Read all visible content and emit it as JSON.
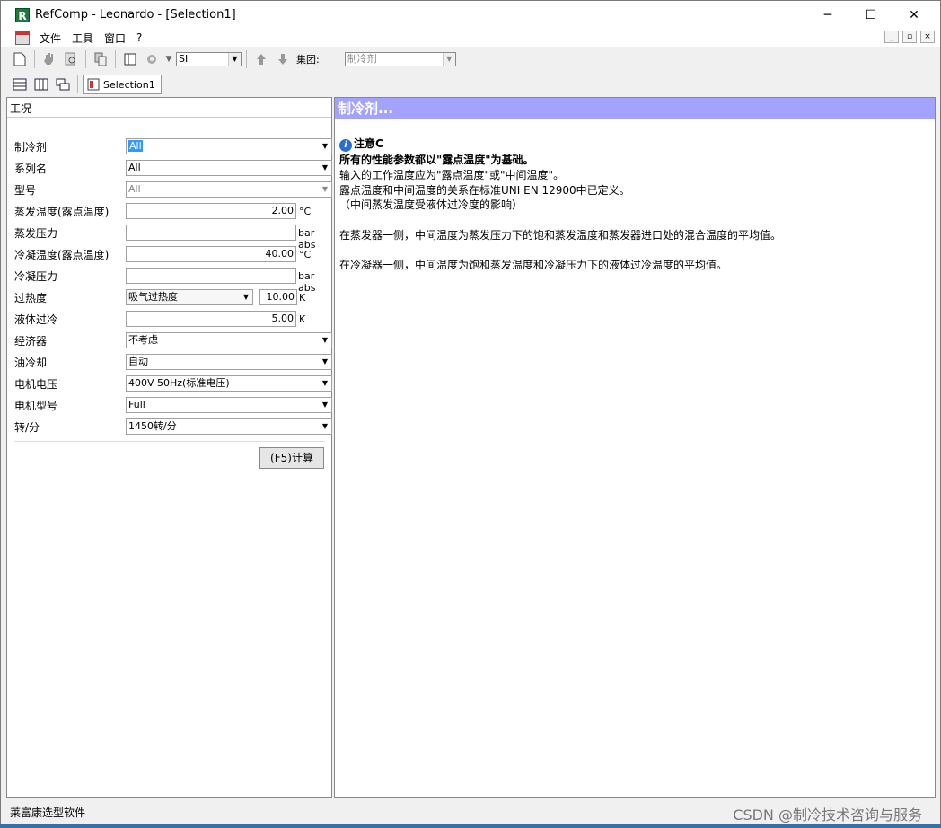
{
  "window": {
    "title": "RefComp - Leonardo  - [Selection1]",
    "app_icon": "R",
    "minimize": "─",
    "maximize": "☐",
    "close": "✕"
  },
  "menu": {
    "items": [
      "文件",
      "工具",
      "窗口",
      "?"
    ]
  },
  "mdi": {
    "min": "_",
    "restore": "▫",
    "close": "×"
  },
  "toolbar": {
    "units_value": "SI",
    "group_label": "集团:",
    "group_value": "制冷剂"
  },
  "tabs": {
    "selection_label": "Selection1"
  },
  "left_panel": {
    "title": "工况",
    "rows": [
      {
        "label": "制冷剂",
        "value": "All",
        "unit": ""
      },
      {
        "label": "系列名",
        "value": "All",
        "unit": ""
      },
      {
        "label": "型号",
        "value": "All",
        "unit": ""
      },
      {
        "label": "蒸发温度(露点温度)",
        "value": "2.00",
        "unit": "°C"
      },
      {
        "label": "蒸发压力",
        "value": "",
        "unit": "bar abs"
      },
      {
        "label": "冷凝温度(露点温度)",
        "value": "40.00",
        "unit": "°C"
      },
      {
        "label": "冷凝压力",
        "value": "",
        "unit": "bar abs"
      },
      {
        "label": "过热度",
        "value": "吸气过热度",
        "value2": "10.00",
        "unit": "K"
      },
      {
        "label": "液体过冷",
        "value": "5.00",
        "unit": "K"
      },
      {
        "label": "经济器",
        "value": "不考虑",
        "unit": ""
      },
      {
        "label": "油冷却",
        "value": "自动",
        "unit": ""
      },
      {
        "label": "电机电压",
        "value": "400V 50Hz(标准电压)",
        "unit": ""
      },
      {
        "label": "电机型号",
        "value": "Full",
        "unit": ""
      },
      {
        "label": "转/分",
        "value": "1450转/分",
        "unit": ""
      }
    ],
    "calc_button": "(F5)计算"
  },
  "right_panel": {
    "title": "制冷剂...",
    "note_title": "注意C",
    "lines": [
      "所有的性能参数都以\"露点温度\"为基础。",
      "输入的工作温度应为\"露点温度\"或\"中间温度\"。",
      "露点温度和中间温度的关系在标准UNI EN 12900中已定义。",
      "（中间蒸发温度受液体过冷度的影响）",
      "在蒸发器一侧，中间温度为蒸发压力下的饱和蒸发温度和蒸发器进口处的混合温度的平均值。",
      "在冷凝器一侧，中间温度为饱和蒸发温度和冷凝压力下的液体过冷温度的平均值。"
    ]
  },
  "status": {
    "text": "莱富康选型软件",
    "watermark": "CSDN @制冷技术咨询与服务"
  }
}
